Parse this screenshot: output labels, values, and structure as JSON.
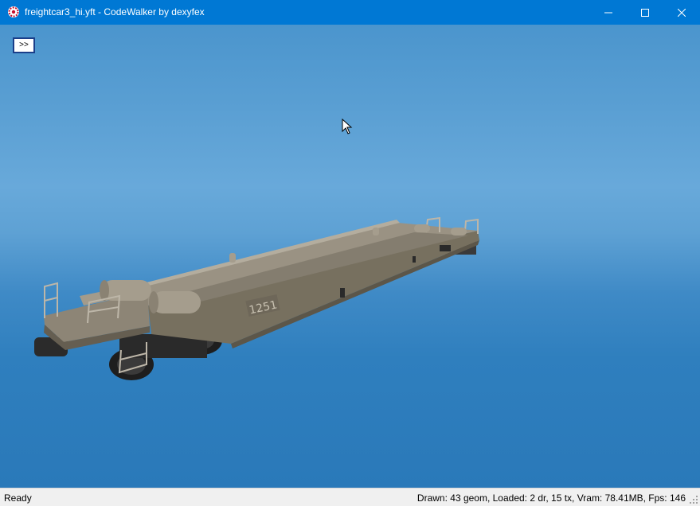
{
  "window": {
    "title": "freightcar3_hi.yft - CodeWalker by dexyfex",
    "icon": "codewalker-app-icon",
    "controls": {
      "minimize_icon": "minimize-icon",
      "maximize_icon": "maximize-icon",
      "close_icon": "close-icon"
    }
  },
  "viewport": {
    "toggle_button_label": ">>",
    "model_marking": "1251",
    "background_color": "#5ea1d4"
  },
  "statusbar": {
    "status": "Ready",
    "stats": "Drawn: 43 geom, Loaded: 2 dr, 15 tx, Vram: 78.41MB, Fps: 146"
  },
  "colors": {
    "titlebar": "#0078d4",
    "model": "#8a8273"
  }
}
